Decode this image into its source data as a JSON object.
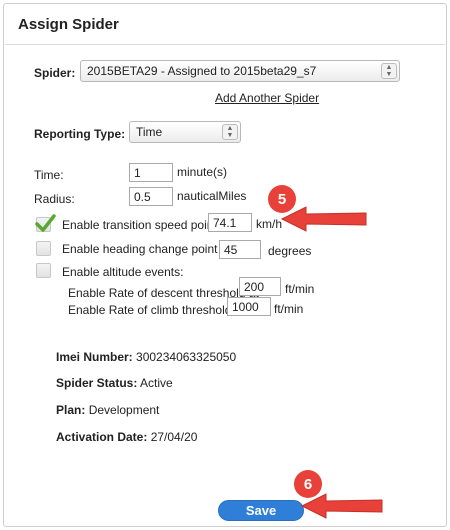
{
  "title": "Assign Spider",
  "spider": {
    "label": "Spider:",
    "value": "2015BETA29 - Assigned to 2015beta29_s7",
    "add_link": "Add Another Spider"
  },
  "reporting": {
    "label": "Reporting Type:",
    "value": "Time"
  },
  "time": {
    "label": "Time:",
    "value": "1",
    "unit": "minute(s)"
  },
  "radius": {
    "label": "Radius:",
    "value": "0.5",
    "unit": "nauticalMiles"
  },
  "transition": {
    "label": "Enable transition speed point at",
    "value": "74.1",
    "unit": "km/h",
    "checked": true
  },
  "heading": {
    "label": "Enable heading change point at",
    "value": "45",
    "unit": "degrees",
    "checked": false
  },
  "altitude": {
    "label": "Enable altitude events:",
    "checked": false
  },
  "descent": {
    "label": "Enable Rate of descent threshold at",
    "value": "200",
    "unit": "ft/min"
  },
  "climb": {
    "label": "Enable Rate of climb threshold at",
    "value": "1000",
    "unit": "ft/min"
  },
  "info": {
    "imei_label": "Imei Number:",
    "imei_value": "300234063325050",
    "status_label": "Spider Status:",
    "status_value": "Active",
    "plan_label": "Plan:",
    "plan_value": "Development",
    "activation_label": "Activation Date:",
    "activation_value": "27/04/20"
  },
  "annotations": {
    "step5": "5",
    "step6": "6",
    "color": "#e8413a"
  },
  "save_label": "Save",
  "colors": {
    "accent": "#2f7fd8",
    "check": "#5aa832"
  }
}
